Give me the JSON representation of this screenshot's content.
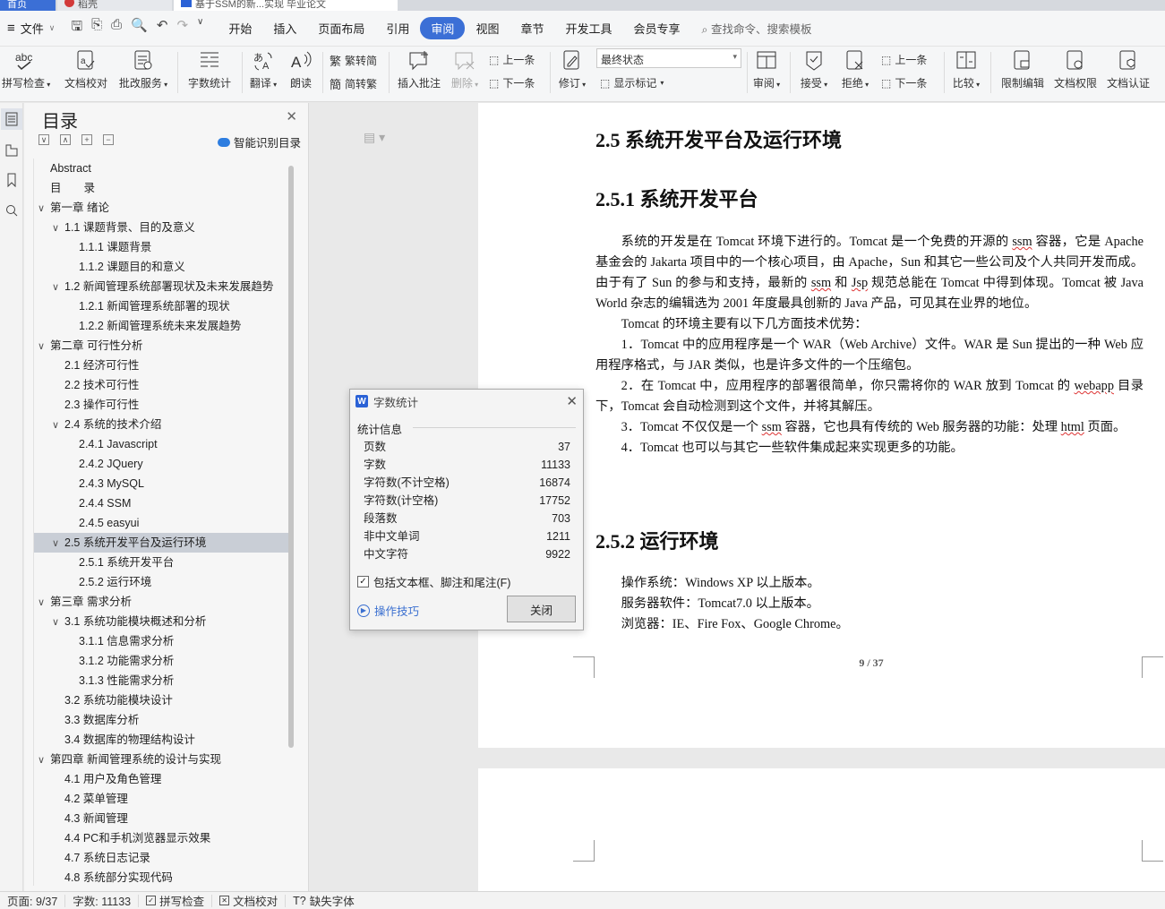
{
  "tabs": {
    "home": "首页",
    "second": "稻壳",
    "doc": "基于SSM的新...实现 毕业论文"
  },
  "menubar": {
    "file": "文件",
    "items": [
      "开始",
      "插入",
      "页面布局",
      "引用",
      "审阅",
      "视图",
      "章节",
      "开发工具",
      "会员专享"
    ],
    "active": "审阅",
    "search": "查找命令、搜索模板"
  },
  "ribbon": {
    "spellcheck": "拼写检查",
    "doc_proof": "文档校对",
    "batch": "批改服务",
    "wordcount": "字数统计",
    "translate": "翻译",
    "read": "朗读",
    "trad": "繁转简",
    "simp": "简转繁",
    "insert_comment": "插入批注",
    "delete": "删除",
    "prev": "上一条",
    "next": "下一条",
    "revise": "修订",
    "state": "最终状态",
    "show_marks": "显示标记",
    "review": "审阅",
    "accept": "接受",
    "reject": "拒绝",
    "prev2": "上一条",
    "next2": "下一条",
    "compare": "比较",
    "restrict": "限制编辑",
    "rights": "文档权限",
    "certify": "文档认证"
  },
  "toc": {
    "title": "目录",
    "smart": "智能识别目录",
    "items": [
      {
        "text": "Abstract",
        "level": 0,
        "toggle": ""
      },
      {
        "text": "目　　录",
        "level": 0,
        "toggle": ""
      },
      {
        "text": "第一章  绪论",
        "level": 0,
        "toggle": "∨"
      },
      {
        "text": "1.1  课题背景、目的及意义",
        "level": 1,
        "toggle": "∨"
      },
      {
        "text": "1.1.1  课题背景",
        "level": 2,
        "toggle": ""
      },
      {
        "text": "1.1.2  课题目的和意义",
        "level": 2,
        "toggle": ""
      },
      {
        "text": "1.2  新闻管理系统部署现状及未来发展趋势",
        "level": 1,
        "toggle": "∨"
      },
      {
        "text": "1.2.1  新闻管理系统部署的现状",
        "level": 2,
        "toggle": ""
      },
      {
        "text": "1.2.2  新闻管理系统未来发展趋势",
        "level": 2,
        "toggle": ""
      },
      {
        "text": "第二章  可行性分析",
        "level": 0,
        "toggle": "∨"
      },
      {
        "text": "2.1  经济可行性",
        "level": 1,
        "toggle": ""
      },
      {
        "text": "2.2  技术可行性",
        "level": 1,
        "toggle": ""
      },
      {
        "text": "2.3  操作可行性",
        "level": 1,
        "toggle": ""
      },
      {
        "text": "2.4  系统的技术介绍",
        "level": 1,
        "toggle": "∨"
      },
      {
        "text": "2.4.1 Javascript",
        "level": 2,
        "toggle": ""
      },
      {
        "text": "2.4.2 JQuery",
        "level": 2,
        "toggle": ""
      },
      {
        "text": "2.4.3 MySQL",
        "level": 2,
        "toggle": ""
      },
      {
        "text": "2.4.4 SSM",
        "level": 2,
        "toggle": ""
      },
      {
        "text": "2.4.5 easyui",
        "level": 2,
        "toggle": ""
      },
      {
        "text": "2.5  系统开发平台及运行环境",
        "level": 1,
        "toggle": "∨",
        "selected": true
      },
      {
        "text": "2.5.1  系统开发平台",
        "level": 2,
        "toggle": ""
      },
      {
        "text": "2.5.2  运行环境",
        "level": 2,
        "toggle": ""
      },
      {
        "text": "第三章  需求分析",
        "level": 0,
        "toggle": "∨"
      },
      {
        "text": "3.1  系统功能模块概述和分析",
        "level": 1,
        "toggle": "∨"
      },
      {
        "text": "3.1.1  信息需求分析",
        "level": 2,
        "toggle": ""
      },
      {
        "text": "3.1.2  功能需求分析",
        "level": 2,
        "toggle": ""
      },
      {
        "text": "3.1.3  性能需求分析",
        "level": 2,
        "toggle": ""
      },
      {
        "text": "3.2  系统功能模块设计",
        "level": 1,
        "toggle": ""
      },
      {
        "text": "3.3  数据库分析",
        "level": 1,
        "toggle": ""
      },
      {
        "text": "3.4  数据库的物理结构设计",
        "level": 1,
        "toggle": ""
      },
      {
        "text": "第四章  新闻管理系统的设计与实现",
        "level": 0,
        "toggle": "∨"
      },
      {
        "text": "4.1    用户及角色管理",
        "level": 1,
        "toggle": ""
      },
      {
        "text": "4.2    菜单管理",
        "level": 1,
        "toggle": ""
      },
      {
        "text": "4.3    新闻管理",
        "level": 1,
        "toggle": ""
      },
      {
        "text": "4.4    PC和手机浏览器显示效果",
        "level": 1,
        "toggle": ""
      },
      {
        "text": "4.7    系统日志记录",
        "level": 1,
        "toggle": ""
      },
      {
        "text": "4.8    系统部分实现代码",
        "level": 1,
        "toggle": ""
      }
    ]
  },
  "doc": {
    "h_25": "2.5  系统开发平台及运行环境",
    "h_251": "2.5.1  系统开发平台",
    "p1_a": "系统的开发是在 Tomcat 环境下进行的。Tomcat 是一个免费的开源的 ",
    "p1_ssm": "ssm",
    "p1_b": " 容器，它是 Apache 基金会的 Jakarta 项目中的一个核心项目，由 Apache，Sun 和其它一些公司及个人共同开发而成。由于有了 Sun 的参与和支持，最新的 ",
    "p1_ssm2": "ssm",
    "p1_c": " 和 ",
    "p1_jsp": "Jsp",
    "p1_d": " 规范总能在 Tomcat 中得到体现。Tomcat 被 Java World 杂志的编辑选为 2001 年度最具创新的 Java 产品，可见其在业界的地位。",
    "p2": "Tomcat 的环境主要有以下几方面技术优势：",
    "p3": "1．Tomcat 中的应用程序是一个 WAR（Web Archive）文件。WAR 是 Sun 提出的一种 Web 应用程序格式，与 JAR 类似，也是许多文件的一个压缩包。",
    "p4_a": "2．在 Tomcat 中，应用程序的部署很简单，你只需将你的 WAR 放到 Tomcat 的 ",
    "p4_webapp": "webapp",
    "p4_b": " 目录下，Tomcat 会自动检测到这个文件，并将其解压。",
    "p5_a": "3．Tomcat 不仅仅是一个 ",
    "p5_ssm": "ssm",
    "p5_b": " 容器，它也具有传统的 Web 服务器的功能：处理 ",
    "p5_html": "html",
    "p5_c": " 页面。",
    "p6": "4．Tomcat 也可以与其它一些软件集成起来实现更多的功能。",
    "h_252": "2.5.2  运行环境",
    "env1": "操作系统：Windows XP 以上版本。",
    "env2": "服务器软件：Tomcat7.0 以上版本。",
    "env3": "浏览器：IE、Fire Fox、Google Chrome。",
    "pagenum": "9 / 37"
  },
  "dialog": {
    "title": "字数统计",
    "section": "统计信息",
    "stats": [
      {
        "label": "页数",
        "value": "37"
      },
      {
        "label": "字数",
        "value": "11133"
      },
      {
        "label": "字符数(不计空格)",
        "value": "16874"
      },
      {
        "label": "字符数(计空格)",
        "value": "17752"
      },
      {
        "label": "段落数",
        "value": "703"
      },
      {
        "label": "非中文单词",
        "value": "1211"
      },
      {
        "label": "中文字符",
        "value": "9922"
      }
    ],
    "include": "包括文本框、脚注和尾注(F)",
    "tips": "操作技巧",
    "close": "关闭"
  },
  "status": {
    "page": "页面: 9/37",
    "words": "字数: 11133",
    "spell": "拼写检查",
    "proof": "文档校对",
    "font": "缺失字体"
  }
}
